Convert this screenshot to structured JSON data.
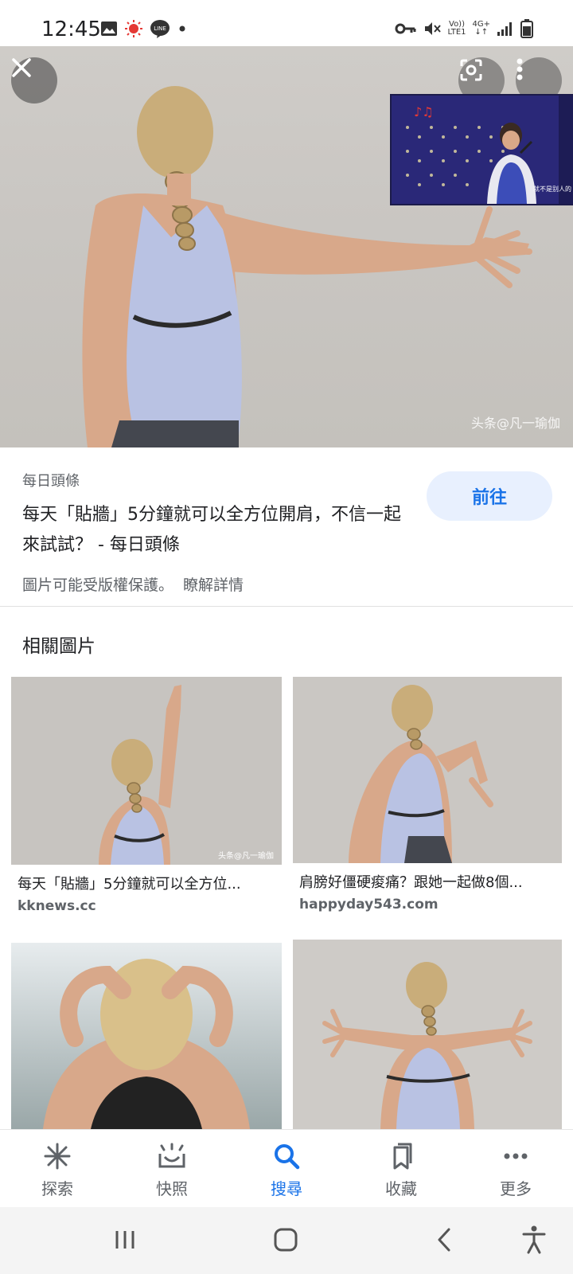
{
  "status_bar": {
    "time": "12:45",
    "volte_label": "Vo))",
    "lte_label": "LTE1",
    "network_label": "4G+"
  },
  "hero": {
    "watermark": "头条@凡一瑜伽",
    "pip_caption": "就不是别人的"
  },
  "result": {
    "source": "每日頭條",
    "title": "每天「貼牆」5分鐘就可以全方位開肩，不信一起來試試？ - 每日頭條",
    "go_label": "前往",
    "copyright_notice": "圖片可能受版權保護。",
    "learn_more": "瞭解詳情"
  },
  "related": {
    "heading": "相關圖片",
    "items": [
      {
        "title": "每天「貼牆」5分鐘就可以全方位...",
        "source": "kknews.cc"
      },
      {
        "title": "肩膀好僵硬痠痛？跟她一起做8個...",
        "source": "happyday543.com"
      },
      {
        "title": "",
        "source": ""
      },
      {
        "title": "",
        "source": ""
      }
    ]
  },
  "bottom_nav": {
    "items": [
      {
        "label": "探索",
        "icon": "asterisk-icon"
      },
      {
        "label": "快照",
        "icon": "snapshot-icon"
      },
      {
        "label": "搜尋",
        "icon": "search-icon"
      },
      {
        "label": "收藏",
        "icon": "bookmarks-icon"
      },
      {
        "label": "更多",
        "icon": "more-horizontal-icon"
      }
    ],
    "active_index": 2
  },
  "colors": {
    "accent": "#1a73e8",
    "accent_bg": "#e8f0fe",
    "text_secondary": "#5f6368"
  }
}
